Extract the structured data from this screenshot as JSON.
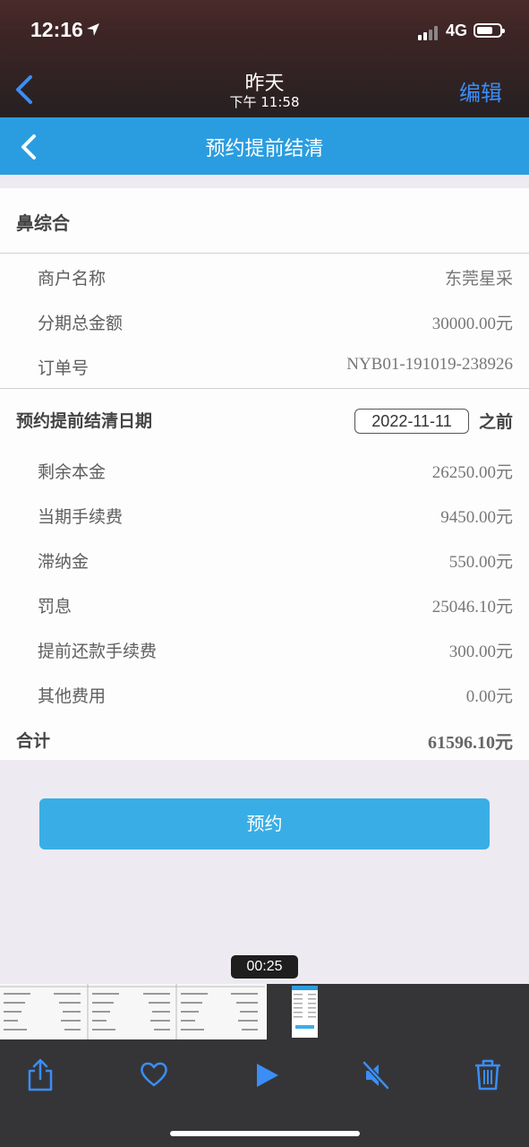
{
  "status_bar": {
    "time": "12:16",
    "network": "4G"
  },
  "photo_header": {
    "title": "昨天",
    "subtitle": "下午 11:58",
    "edit_label": "编辑"
  },
  "app_header": {
    "title": "预约提前结清"
  },
  "product": {
    "name": "鼻综合"
  },
  "details": [
    {
      "label": "商户名称",
      "value": "东莞星采"
    },
    {
      "label": "分期总金额",
      "value": "30000.00元"
    },
    {
      "label": "订单号",
      "value": "NYB01-191019-238926"
    }
  ],
  "settlement": {
    "date_label": "预约提前结清日期",
    "date_value": "2022-11-11",
    "date_suffix": "之前"
  },
  "fees": [
    {
      "label": "剩余本金",
      "value": "26250.00元"
    },
    {
      "label": "当期手续费",
      "value": "9450.00元"
    },
    {
      "label": "滞纳金",
      "value": "550.00元"
    },
    {
      "label": "罚息",
      "value": "25046.10元"
    },
    {
      "label": "提前还款手续费",
      "value": "300.00元"
    },
    {
      "label": "其他费用",
      "value": "0.00元"
    }
  ],
  "total": {
    "label": "合计",
    "value": "61596.10元"
  },
  "action": {
    "button_label": "预约"
  },
  "video": {
    "timecode": "00:25"
  },
  "toolbar": {
    "icons": [
      "share-icon",
      "heart-icon",
      "play-icon",
      "muted-speaker-icon",
      "trash-icon"
    ],
    "accent_color": "#3a8ef6"
  },
  "colors": {
    "app_header": "#2a9de0",
    "button": "#39aee6"
  }
}
